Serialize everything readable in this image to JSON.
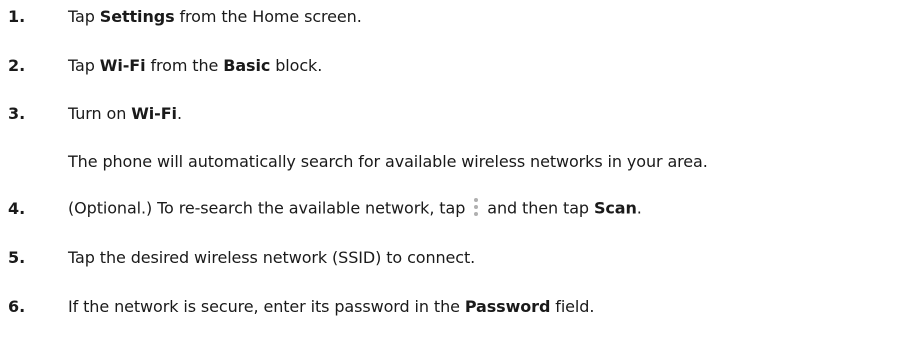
{
  "steps": [
    {
      "number": "1.",
      "parts": [
        {
          "t": "Tap ",
          "b": false
        },
        {
          "t": "Settings",
          "b": true
        },
        {
          "t": " from the Home screen.",
          "b": false
        }
      ]
    },
    {
      "number": "2.",
      "parts": [
        {
          "t": "Tap ",
          "b": false
        },
        {
          "t": "Wi-Fi",
          "b": true
        },
        {
          "t": " from the ",
          "b": false
        },
        {
          "t": "Basic",
          "b": true
        },
        {
          "t": " block.",
          "b": false
        }
      ]
    },
    {
      "number": "3.",
      "parts": [
        {
          "t": "Turn on ",
          "b": false
        },
        {
          "t": "Wi-Fi",
          "b": true
        },
        {
          "t": ".",
          "b": false
        }
      ]
    },
    {
      "note": "The phone will automatically search for available wireless networks in your area."
    },
    {
      "number": "4.",
      "parts": [
        {
          "t": "(Optional.) To re-search the available network, tap",
          "b": false
        },
        {
          "icon": "overflow-menu-icon"
        },
        {
          "t": "and then tap ",
          "b": false
        },
        {
          "t": "Scan",
          "b": true
        },
        {
          "t": ".",
          "b": false
        }
      ]
    },
    {
      "number": "5.",
      "parts": [
        {
          "t": "Tap the desired wireless network (SSID) to connect.",
          "b": false
        }
      ]
    },
    {
      "number": "6.",
      "parts": [
        {
          "t": "If the network is secure, enter its password in the ",
          "b": false
        },
        {
          "t": "Password",
          "b": true
        },
        {
          "t": " field.",
          "b": false
        }
      ]
    }
  ],
  "colors": {
    "text": "#1a1a1a",
    "icon_dots": "#b0b0b0",
    "background": "#ffffff"
  }
}
